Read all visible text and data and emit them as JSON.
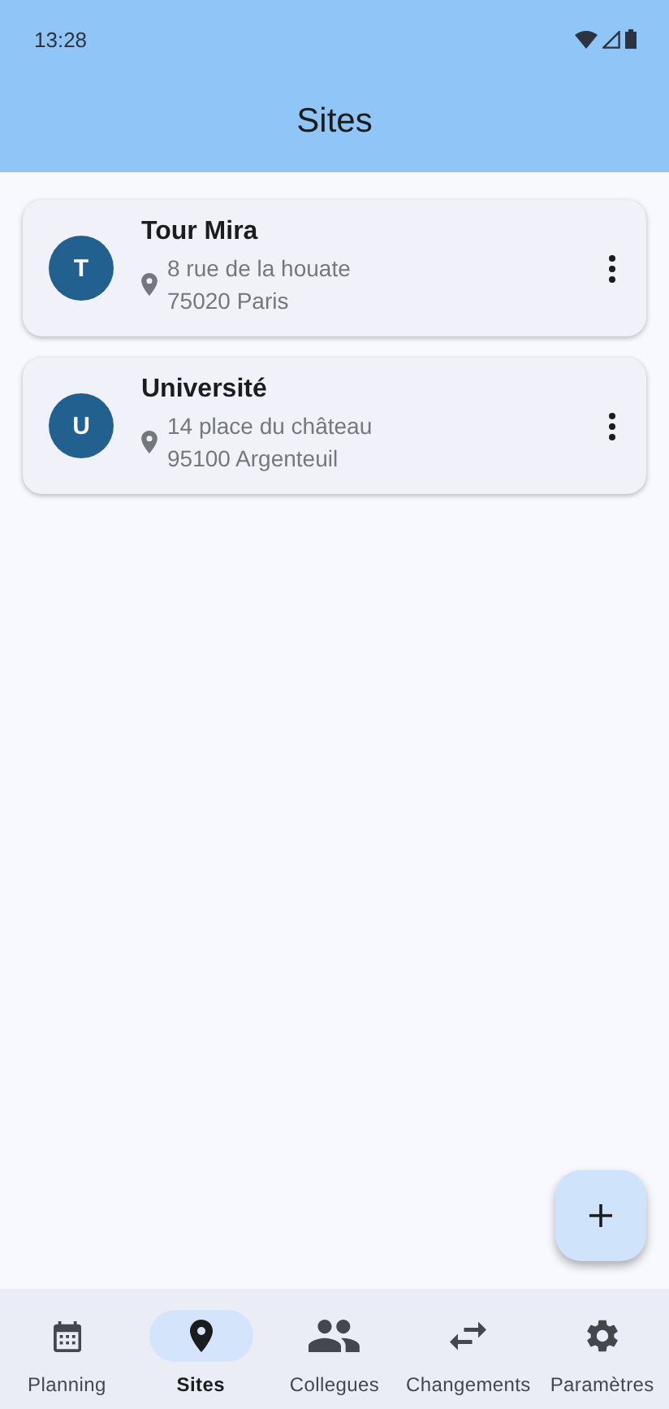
{
  "status_bar": {
    "time": "13:28"
  },
  "app_bar": {
    "title": "Sites"
  },
  "sites": [
    {
      "initial": "T",
      "name": "Tour Mira",
      "address_line_1": "8 rue de la houate",
      "address_line_2": "75020 Paris"
    },
    {
      "initial": "U",
      "name": "Université",
      "address_line_1": "14 place du château",
      "address_line_2": "95100 Argenteuil"
    }
  ],
  "nav": [
    {
      "kind": "calendar",
      "label": "Planning",
      "selected": false
    },
    {
      "kind": "pin",
      "label": "Sites",
      "selected": true
    },
    {
      "kind": "people",
      "label": "Collegues",
      "selected": false
    },
    {
      "kind": "swap",
      "label": "Changements",
      "selected": false
    },
    {
      "kind": "gear",
      "label": "Paramètres",
      "selected": false
    }
  ]
}
